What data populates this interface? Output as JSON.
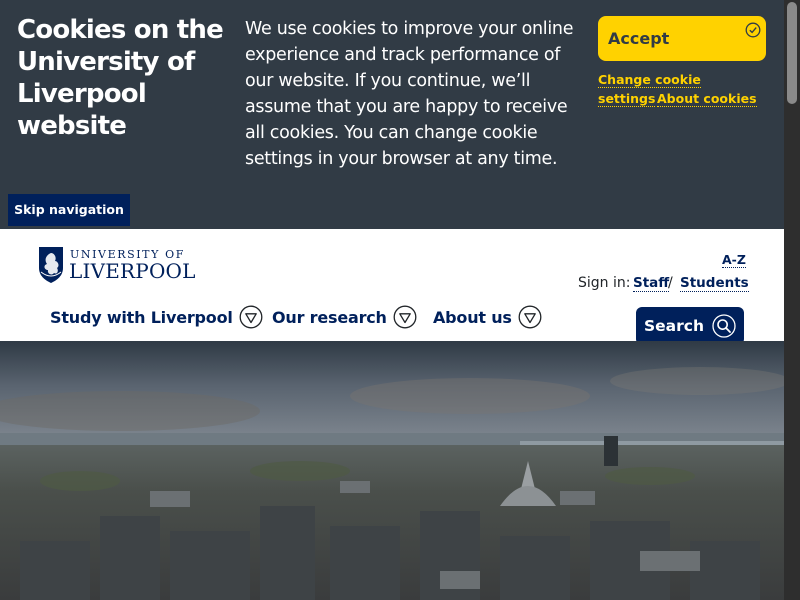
{
  "cookie_banner": {
    "title": "Cookies on the University of Liverpool website",
    "message": "We use cookies to improve your online experience and track performance of our website. If you continue, we’ll assume that you are happy to receive all cookies. You can change cookie settings in your browser at any time.",
    "accept_label": "Accept",
    "change_settings_line1": "Change cookie",
    "change_settings_line2": "settings",
    "about_cookies": "About cookies",
    "colors": {
      "background": "#313b45",
      "accent": "#ffd200"
    }
  },
  "skip_navigation": "Skip navigation",
  "header": {
    "logo_line1": "UNIVERSITY OF",
    "logo_line2": "LIVERPOOL",
    "az_label": "A-Z",
    "signin_label": "Sign in:",
    "staff_label": "Staff",
    "separator": "/",
    "students_label": "Students",
    "nav": [
      {
        "label": "Study with Liverpool",
        "icon": "chevron-down-circle-icon"
      },
      {
        "label": "Our research",
        "icon": "chevron-down-circle-icon"
      },
      {
        "label": "About us",
        "icon": "chevron-down-circle-icon"
      }
    ],
    "search_label": "Search",
    "colors": {
      "brand": "#00205b"
    }
  }
}
